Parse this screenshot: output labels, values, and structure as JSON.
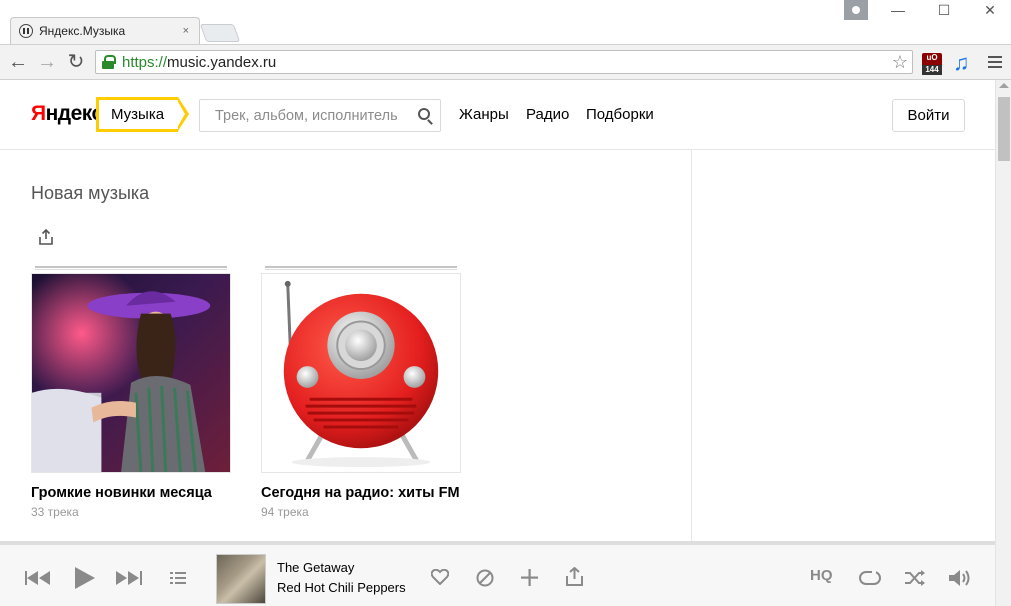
{
  "browser": {
    "tab_title": "Яндекс.Музыка",
    "tab_close": "×",
    "url_scheme": "https://",
    "url_host": "music.yandex.ru",
    "ext_badge": "144",
    "ext_label": "uO",
    "win_minimize": "—",
    "win_maximize": "☐",
    "win_close": "✕",
    "back": "←",
    "forward": "→",
    "reload": "↻",
    "star": "☆"
  },
  "header": {
    "logo_y": "Я",
    "logo_rest": "ндекс",
    "service_name": "Музыка",
    "search_placeholder": "Трек, альбом, исполнитель",
    "nav": [
      "Жанры",
      "Радио",
      "Подборки"
    ],
    "login_label": "Войти"
  },
  "main": {
    "section_title": "Новая музыка",
    "cards": [
      {
        "title": "Громкие новинки месяца",
        "count": "33 трека"
      },
      {
        "title": "Сегодня на радио: хиты FM",
        "count": "94 трека"
      }
    ]
  },
  "player": {
    "track_title": "The Getaway",
    "track_artist": "Red Hot Chili Peppers",
    "hq_label": "HQ"
  },
  "colors": {
    "brand_yellow": "#ffcc00",
    "brand_red": "#ff0000",
    "secure_green": "#2a8a2a"
  }
}
